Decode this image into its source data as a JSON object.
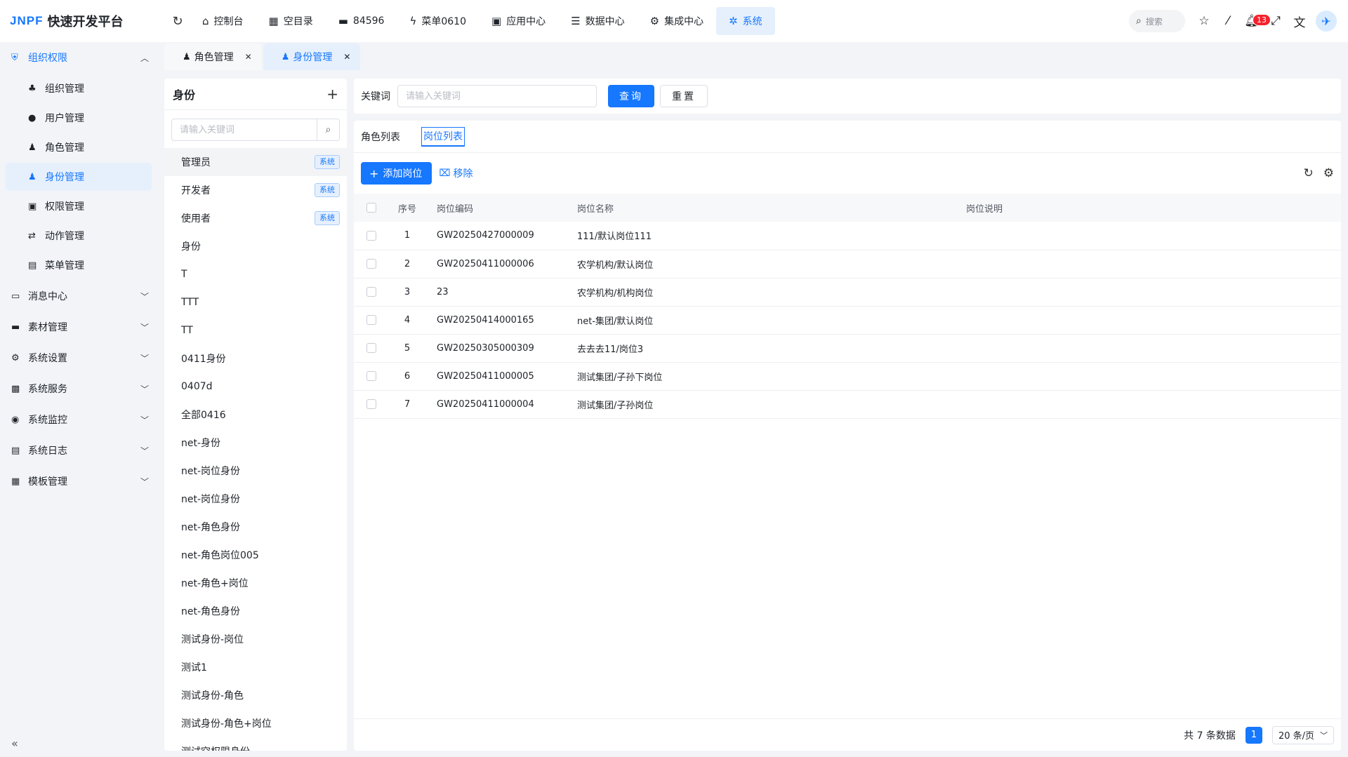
{
  "app": {
    "logo_mark": "JNPF",
    "title": "快速开发平台"
  },
  "topnav": [
    {
      "label": "控制台",
      "icon": "home-icon"
    },
    {
      "label": "空目录",
      "icon": "grid-icon"
    },
    {
      "label": "84596",
      "icon": "folder-icon"
    },
    {
      "label": "菜单0610",
      "icon": "lightning-icon"
    },
    {
      "label": "应用中心",
      "icon": "apps-icon"
    },
    {
      "label": "数据中心",
      "icon": "database-icon"
    },
    {
      "label": "集成中心",
      "icon": "integration-icon"
    },
    {
      "label": "系统",
      "icon": "gear-icon",
      "active": true
    }
  ],
  "header": {
    "search_label": "搜索",
    "notification_count": "13"
  },
  "sidebar": {
    "group_org": "组织权限",
    "subs": [
      {
        "label": "组织管理"
      },
      {
        "label": "用户管理"
      },
      {
        "label": "角色管理"
      },
      {
        "label": "身份管理",
        "active": true
      },
      {
        "label": "权限管理"
      },
      {
        "label": "动作管理"
      },
      {
        "label": "菜单管理"
      }
    ],
    "groups": [
      "消息中心",
      "素材管理",
      "系统设置",
      "系统服务",
      "系统监控",
      "系统日志",
      "模板管理"
    ]
  },
  "pagetabs": [
    {
      "label": "角色管理"
    },
    {
      "label": "身份管理",
      "active": true
    }
  ],
  "tree": {
    "title": "身份",
    "search_placeholder": "请输入关键词",
    "items": [
      {
        "label": "管理员",
        "tag": "系统"
      },
      {
        "label": "开发者",
        "tag": "系统"
      },
      {
        "label": "使用者",
        "tag": "系统"
      },
      {
        "label": "身份"
      },
      {
        "label": "T"
      },
      {
        "label": "TTT"
      },
      {
        "label": "TT"
      },
      {
        "label": "0411身份"
      },
      {
        "label": "0407d"
      },
      {
        "label": "全部0416"
      },
      {
        "label": "net-身份"
      },
      {
        "label": "net-岗位身份"
      },
      {
        "label": "net-岗位身份"
      },
      {
        "label": "net-角色身份"
      },
      {
        "label": "net-角色岗位005"
      },
      {
        "label": "net-角色+岗位"
      },
      {
        "label": "net-角色身份"
      },
      {
        "label": "测试身份-岗位"
      },
      {
        "label": "测试1"
      },
      {
        "label": "测试身份-角色"
      },
      {
        "label": "测试身份-角色+岗位"
      },
      {
        "label": "测试空权限身份"
      }
    ]
  },
  "query": {
    "keyword_label": "关键词",
    "keyword_placeholder": "请输入关键词",
    "search_btn": "查询",
    "reset_btn": "重置"
  },
  "subtabs": [
    {
      "label": "角色列表"
    },
    {
      "label": "岗位列表",
      "active": true
    }
  ],
  "toolbar": {
    "add_label": "添加岗位",
    "remove_label": "移除"
  },
  "table": {
    "headers": {
      "index": "序号",
      "code": "岗位编码",
      "name": "岗位名称",
      "desc": "岗位说明"
    },
    "rows": [
      {
        "index": "1",
        "code": "GW20250427000009",
        "name": "111/默认岗位111",
        "desc": ""
      },
      {
        "index": "2",
        "code": "GW20250411000006",
        "name": "农学机构/默认岗位",
        "desc": ""
      },
      {
        "index": "3",
        "code": "23",
        "name": "农学机构/机构岗位",
        "desc": ""
      },
      {
        "index": "4",
        "code": "GW20250414000165",
        "name": "net-集团/默认岗位",
        "desc": ""
      },
      {
        "index": "5",
        "code": "GW20250305000309",
        "name": "去去去11/岗位3",
        "desc": ""
      },
      {
        "index": "6",
        "code": "GW20250411000005",
        "name": "测试集团/子孙下岗位",
        "desc": ""
      },
      {
        "index": "7",
        "code": "GW20250411000004",
        "name": "测试集团/子孙岗位",
        "desc": ""
      }
    ]
  },
  "pagination": {
    "total_text": "共 7 条数据",
    "current_page": "1",
    "page_size": "20 条/页"
  }
}
